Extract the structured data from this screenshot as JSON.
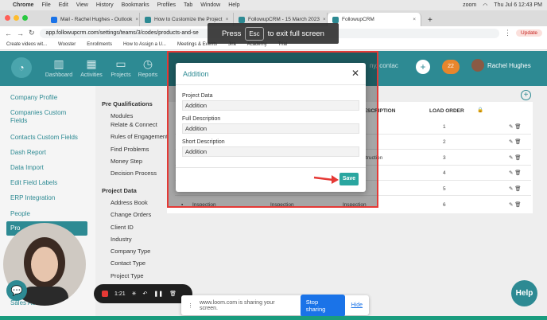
{
  "menubar": {
    "app": "Chrome",
    "items": [
      "File",
      "Edit",
      "View",
      "History",
      "Bookmarks",
      "Profiles",
      "Tab",
      "Window",
      "Help"
    ],
    "right_status": "zoom",
    "datetime": "Thu Jul 6  12:43 PM"
  },
  "tabs": [
    {
      "title": "Mail - Rachel Hughes - Outlook",
      "favicon_color": "#1a73e8"
    },
    {
      "title": "How to Customize the Project",
      "favicon_color": "#2d8a93"
    },
    {
      "title": "FollowupCRM - 15 March 2023",
      "favicon_color": "#2d8a93"
    },
    {
      "title": "FollowupCRM",
      "favicon_color": "#2d8a93"
    }
  ],
  "address": {
    "url": "app.followupcrm.com/settings/teams/3/codes/products-and-se",
    "update_label": "Update"
  },
  "bookmarks": [
    "Create videos wit...",
    "Wooster",
    "Enrollments",
    "How to Assign a U...",
    "Meetings & Events",
    "Jira",
    "Academy",
    "Trial"
  ],
  "fullscreen": {
    "press": "Press",
    "key": "Esc",
    "rest": "to exit full screen"
  },
  "header": {
    "nav": [
      "Dashboard",
      "Activities",
      "Projects",
      "Reports"
    ],
    "search_placeholder": "ny, contac",
    "notification_count": "22",
    "user_name": "Rachel Hughes"
  },
  "sidebar": {
    "items": [
      "Company Profile",
      "Companies Custom Fields",
      "Contacts Custom Fields",
      "Dash Report",
      "Data Import",
      "Edit Field Labels",
      "ERP Integration",
      "People",
      "Pro",
      "Sales Aut..."
    ]
  },
  "middle": {
    "prequal_heading": "Pre Qualifications",
    "prequal_items": [
      "Modules",
      "Relate & Connect",
      "Rules of Engagement",
      "Find Problems",
      "Money Step",
      "Decision Process"
    ],
    "project_heading": "Project Data",
    "project_items": [
      "Address Book",
      "Change Orders",
      "Client ID",
      "Industry",
      "Company Type",
      "Contact Type",
      "Project Type"
    ]
  },
  "table": {
    "col_description": "DESCRIPTION",
    "col_load_order": "LOAD ORDER",
    "load_orders": [
      "1",
      "2",
      "3",
      "4",
      "5",
      "6"
    ],
    "partial_desc": [
      "r",
      "",
      "nstruction",
      "",
      "",
      "Inspection"
    ],
    "last_row": {
      "a": "Inspection",
      "b": "Inspection",
      "c": "Inspection"
    }
  },
  "modal": {
    "title": "Addition",
    "fields": [
      {
        "label": "Project Data",
        "value": "Addition"
      },
      {
        "label": "Full Description",
        "value": "Addition"
      },
      {
        "label": "Short Description",
        "value": "Addition"
      }
    ],
    "save_label": "Save"
  },
  "loom": {
    "timer": "1:21",
    "sharing_text": "www.loom.com is sharing your screen.",
    "stop_label": "Stop sharing",
    "hide_label": "Hide"
  },
  "help_label": "Help",
  "colors": {
    "brand": "#2d8a93",
    "highlight": "#e53935"
  }
}
